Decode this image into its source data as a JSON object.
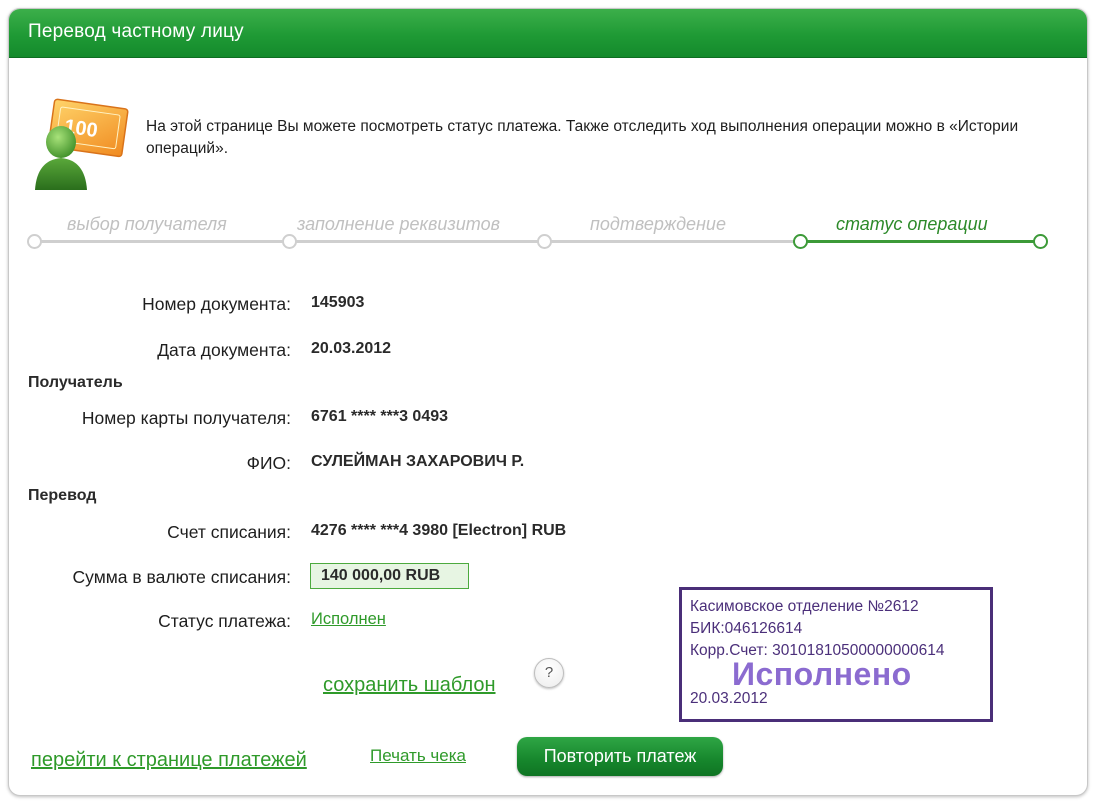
{
  "header": {
    "title": "Перевод частному лицу"
  },
  "intro": {
    "icon": "money-banknote-user-icon",
    "text": "На этой странице Вы можете посмотреть статус платежа. Также отследить ход выполнения операции можно в «Истории операций».",
    "banknote_label": "100"
  },
  "steps": [
    {
      "label": "выбор получателя",
      "active": false
    },
    {
      "label": "заполнение реквизитов",
      "active": false
    },
    {
      "label": "подтверждение",
      "active": false
    },
    {
      "label": "статус операции",
      "active": true
    }
  ],
  "fields": {
    "doc_number": {
      "label": "Номер документа:",
      "value": "145903"
    },
    "doc_date": {
      "label": "Дата документа:",
      "value": "20.03.2012"
    },
    "recipient_section": "Получатель",
    "card_number": {
      "label": "Номер карты получателя:",
      "value": "6761 **** ***3 0493"
    },
    "fio": {
      "label": "ФИО:",
      "value": "СУЛЕЙМАН ЗАХАРОВИЧ Р."
    },
    "transfer_section": "Перевод",
    "account": {
      "label": "Счет списания:",
      "value": "4276 **** ***4 3980  [Electron]  RUB"
    },
    "amount": {
      "label": "Сумма в валюте списания:",
      "value": "140 000,00  RUB"
    },
    "status": {
      "label": "Статус платежа:",
      "value": "Исполнен"
    }
  },
  "links": {
    "save_template": "сохранить шаблон",
    "help": "?",
    "to_payments": "перейти к странице платежей",
    "print_receipt": "Печать чека"
  },
  "buttons": {
    "repeat": "Повторить платеж"
  },
  "stamp": {
    "line1": "Касимовское отделение №2612",
    "line2": "БИК:046126614",
    "line3": "Корр.Счет: 30101810500000000614",
    "big": "Исполнено",
    "date": "20.03.2012"
  },
  "colors": {
    "header_green": "#1f9a35",
    "link_green": "#2f9a2a",
    "stamp_purple": "#4b2f7a",
    "stamp_text_light": "#8b6bd0",
    "amount_bg": "#e7f5e3"
  }
}
